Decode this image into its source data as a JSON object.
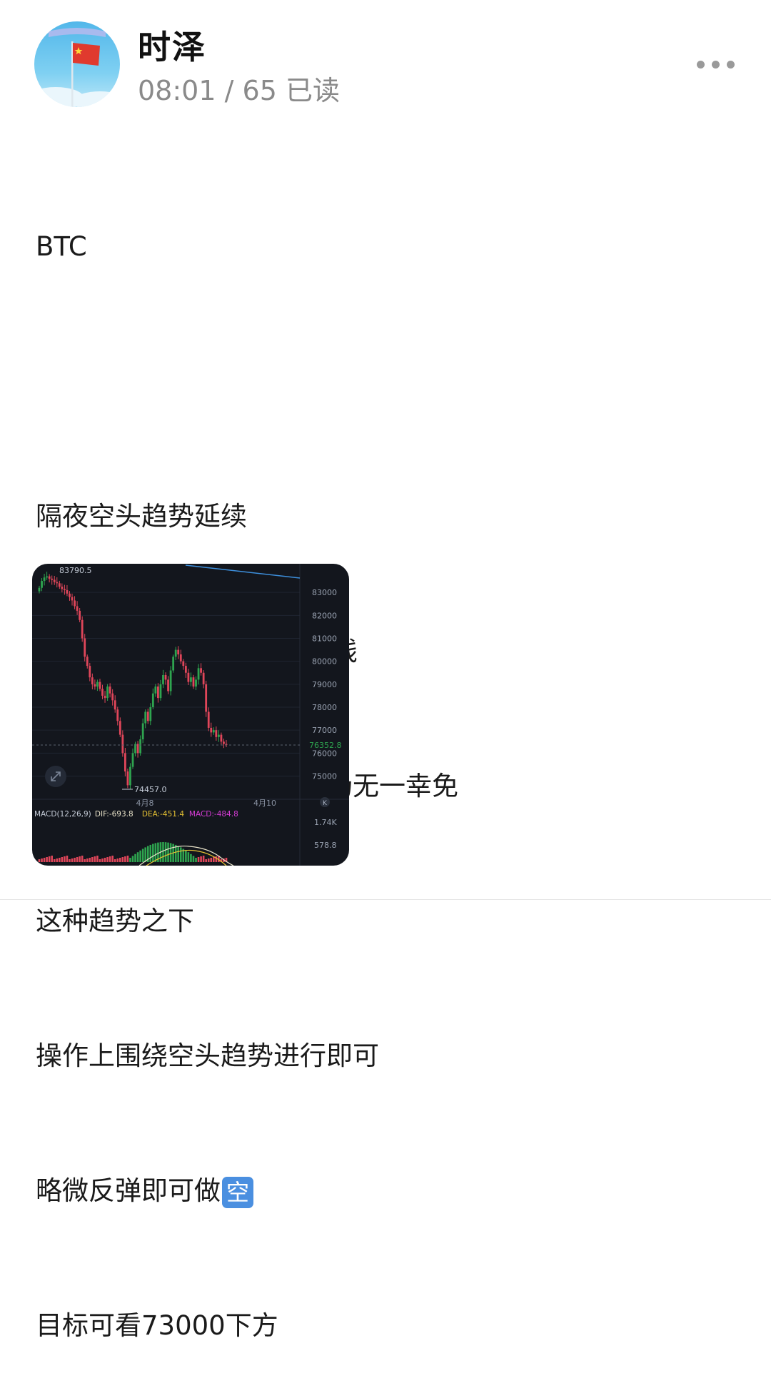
{
  "header": {
    "username": "时泽",
    "time": "08:01",
    "separator": "/",
    "read_count": "65",
    "read_label": "已读"
  },
  "post": {
    "lines": [
      "BTC",
      "",
      "隔夜空头趋势延续",
      "价格最底下跌至76200一线",
      "贸易阴影笼罩之下整个市场无一幸免",
      "这种趋势之下",
      "操作上围绕空头趋势进行即可",
      "略微反弹即可做",
      "目标可看73000下方"
    ],
    "emoji_text": "空"
  },
  "colors": {
    "up": "#2ea44f",
    "down": "#e0465a",
    "chart_bg": "#13161d",
    "ma_line": "#3d8fdc",
    "dif": "#e9e3c9",
    "dea": "#e6c233",
    "macd": "#d63cd6"
  },
  "chart_data": {
    "type": "candlestick",
    "title": "",
    "y_ticks": [
      "83000",
      "82000",
      "81000",
      "80000",
      "79000",
      "78000",
      "77000",
      "76000",
      "75000"
    ],
    "ylim": [
      74300,
      84000
    ],
    "x_labels": [
      "4月8",
      "4月10"
    ],
    "high_label": "83790.5",
    "low_label": "74457.0",
    "last_price": "76352.8",
    "macd": {
      "label": "MACD(12,26,9)",
      "dif_label": "DIF:",
      "dif": "-693.8",
      "dea_label": "DEA:",
      "dea": "-451.4",
      "macd_label": "MACD:",
      "macd": "-484.8",
      "ticks": [
        "1.74K",
        "578.8"
      ]
    },
    "closes": [
      83200,
      83500,
      83650,
      83700,
      83600,
      83550,
      83450,
      83400,
      83250,
      83150,
      83100,
      82950,
      82800,
      82650,
      82400,
      82200,
      81800,
      81000,
      80200,
      79800,
      79300,
      79000,
      78900,
      79100,
      78800,
      78500,
      78400,
      78900,
      78600,
      78300,
      77900,
      77400,
      76800,
      76000,
      75200,
      74600,
      75400,
      76000,
      76400,
      76000,
      76600,
      77300,
      77800,
      77400,
      78000,
      78600,
      78900,
      78400,
      79000,
      79400,
      79200,
      78700,
      79600,
      80200,
      80500,
      80300,
      80000,
      79800,
      79500,
      79100,
      79300,
      78900,
      79200,
      79700,
      79500,
      79000,
      77800,
      77100,
      76900,
      77000,
      76700,
      76800,
      76500,
      76400,
      76350
    ]
  }
}
